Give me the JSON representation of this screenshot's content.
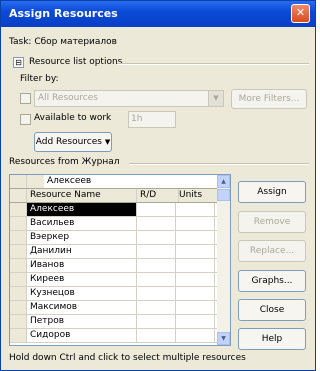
{
  "window": {
    "title": "Assign Resources",
    "close_glyph": "✕"
  },
  "task": {
    "label": "Task:",
    "name": "Сбор материалов"
  },
  "options": {
    "expand_glyph": "⊟",
    "label": "Resource list options"
  },
  "filter": {
    "label": "Filter by:",
    "value": "All Resources",
    "more_button": "More Filters...",
    "available_label": "Available to work",
    "hours_value": "1h",
    "add_button": "Add Resources"
  },
  "resources_from": "Resources from Журнал",
  "grid": {
    "top_name": "Алексеев",
    "headers": {
      "name": "Resource Name",
      "rd": "R/D",
      "units": "Units"
    },
    "rows": [
      {
        "name": "Алексеев",
        "selected": true
      },
      {
        "name": "Васильев"
      },
      {
        "name": "Вэеркер"
      },
      {
        "name": "Данилин"
      },
      {
        "name": "Иванов"
      },
      {
        "name": "Киреев"
      },
      {
        "name": "Кузнецов"
      },
      {
        "name": "Максимов"
      },
      {
        "name": "Петров"
      },
      {
        "name": "Сидоров"
      }
    ]
  },
  "buttons": {
    "assign": "Assign",
    "remove": "Remove",
    "replace": "Replace...",
    "graphs": "Graphs...",
    "close": "Close",
    "help": "Help"
  },
  "footer": "Hold down Ctrl and click to select multiple resources"
}
